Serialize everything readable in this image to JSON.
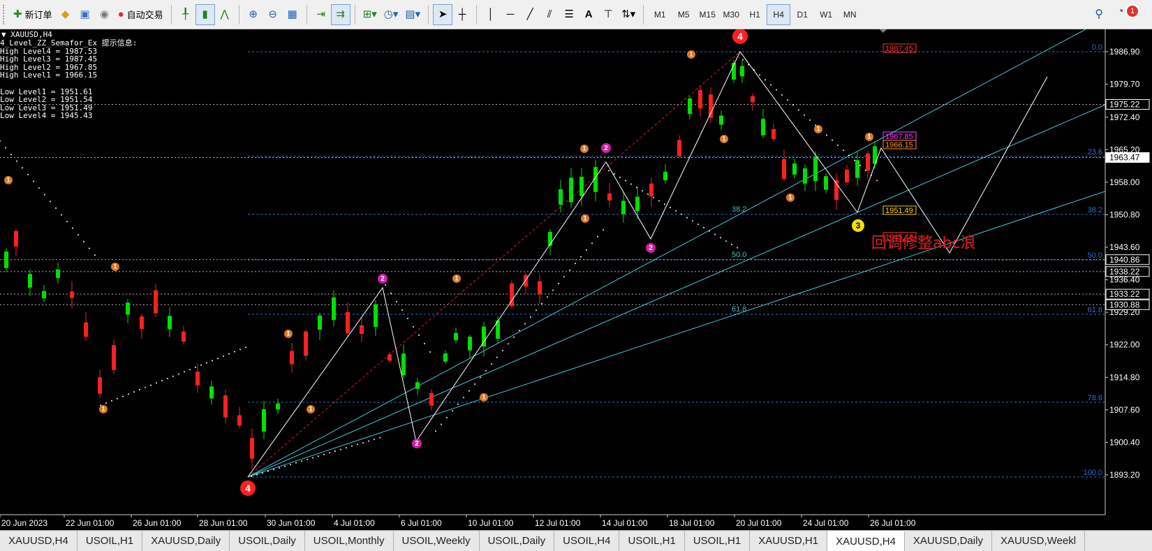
{
  "toolbar": {
    "new_order_label": "新订单",
    "auto_trade_label": "自动交易",
    "timeframes": [
      "M1",
      "M5",
      "M15",
      "M30",
      "H1",
      "H4",
      "D1",
      "W1",
      "MN"
    ],
    "active_timeframe": "H4",
    "notification_count": "1"
  },
  "chart": {
    "symbol_header": "XAUUSD,H4",
    "info_lines": [
      "4_Level_ZZ_Semafor_Ex 提示信息:",
      "High Level4 = 1987.53",
      "High Level3 = 1987.45",
      "High Level2 = 1967.85",
      "High Level1 = 1966.15",
      "",
      "Low Level1 = 1951.61",
      "Low Level2 = 1951.54",
      "Low Level3 = 1951.49",
      "Low Level4 = 1945.43"
    ],
    "annotation_text": "回调修整abc浪",
    "price_axis_labels": [
      "1986.90",
      "1979.70",
      "1972.40",
      "1965.20",
      "1958.00",
      "1950.80",
      "1943.60",
      "1936.40",
      "1929.20",
      "1922.00",
      "1914.80",
      "1907.60",
      "1900.40",
      "1893.20"
    ],
    "price_tags": [
      {
        "label": "1975.22",
        "price": 1975.22,
        "style": "white"
      },
      {
        "label": "1963.47",
        "price": 1963.47,
        "style": "current"
      },
      {
        "label": "1940.86",
        "price": 1940.86,
        "style": "white"
      },
      {
        "label": "1938.22",
        "price": 1938.22,
        "style": "white"
      },
      {
        "label": "1933.22",
        "price": 1933.22,
        "style": "white"
      },
      {
        "label": "1930.88",
        "price": 1930.88,
        "style": "white"
      }
    ],
    "level_labels": [
      {
        "label": "1987.45",
        "color": "#ff3030"
      },
      {
        "label": "1967.85",
        "color": "#ff40ff"
      },
      {
        "label": "1966.15",
        "color": "#ff9030"
      },
      {
        "label": "1951.49",
        "color": "#ffd000"
      },
      {
        "label": "1945.43",
        "color": "#ff3030"
      }
    ],
    "fib_right_labels": [
      "0.0",
      "23.6",
      "38.2",
      "50.0",
      "61.8",
      "78.6",
      "100.0"
    ],
    "fib_inner_labels": [
      "38.2",
      "50.0",
      "61.8"
    ],
    "time_labels": [
      "20 Jun 2023",
      "22 Jun 01:00",
      "26 Jun 01:00",
      "28 Jun 01:00",
      "30 Jun 01:00",
      "4 Jul 01:00",
      "6 Jul 01:00",
      "10 Jul 01:00",
      "12 Jul 01:00",
      "14 Jul 01:00",
      "18 Jul 01:00",
      "20 Jul 01:00",
      "24 Jul 01:00",
      "26 Jul 01:00"
    ],
    "semafor_labels": [
      "1",
      "2",
      "3",
      "4"
    ],
    "colors": {
      "bull": "#00e000",
      "bear": "#ff2020",
      "fib": "#2f6fd0",
      "trend": "#40c8d8",
      "background": "#000000"
    }
  },
  "tabs": [
    {
      "label": "XAUUSD,H4"
    },
    {
      "label": "USOIL,H1"
    },
    {
      "label": "XAUUSD,Daily"
    },
    {
      "label": "USOIL,Daily"
    },
    {
      "label": "USOIL,Monthly"
    },
    {
      "label": "USOIL,Weekly"
    },
    {
      "label": "USOIL,Daily"
    },
    {
      "label": "USOIL,H4"
    },
    {
      "label": "USOIL,H1"
    },
    {
      "label": "USOIL,H1"
    },
    {
      "label": "XAUUSD,H1"
    },
    {
      "label": "XAUUSD,H4",
      "active": true
    },
    {
      "label": "XAUUSD,Daily"
    },
    {
      "label": "XAUUSD,Weekl"
    }
  ]
}
